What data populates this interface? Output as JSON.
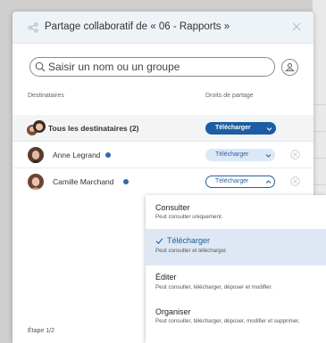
{
  "dialog": {
    "title": "Partage collaboratif de « 06 - Rapports »"
  },
  "search": {
    "placeholder": "Saisir un nom ou un groupe"
  },
  "columns": {
    "recipients": "Destinataires",
    "rights": "Droits de partage"
  },
  "all_recipients": {
    "label": "Tous les destinataires (2)",
    "right": "Télécharger"
  },
  "users": [
    {
      "name": "Anne Legrand",
      "right": "Télécharger"
    },
    {
      "name": "Camille Marchand",
      "right": "Télécharger"
    }
  ],
  "dropdown": {
    "options": [
      {
        "title": "Consulter",
        "desc": "Peut consulter uniquement.",
        "selected": false
      },
      {
        "title": "Télécharger",
        "desc": "Peut consulter et télécharger.",
        "selected": true
      },
      {
        "title": "Éditer",
        "desc": "Peut consulter, télécharger, déposer et modifier.",
        "selected": false
      },
      {
        "title": "Organiser",
        "desc": "Peut consulter, télécharger, déposer, modifier et supprimer.",
        "selected": false
      }
    ]
  },
  "footer": {
    "step": "Étape 1/2"
  },
  "colors": {
    "accent": "#1d5da3",
    "accent_light": "#dce8f5",
    "header_bg": "#eef3f8",
    "verified": "#2f6bb0"
  },
  "icons": {
    "share": "share-icon",
    "close": "close-icon",
    "search": "search-icon",
    "group": "group-icon",
    "verified": "verified-icon",
    "chevron": "chevron-icon",
    "remove": "remove-icon",
    "check": "check-icon"
  }
}
